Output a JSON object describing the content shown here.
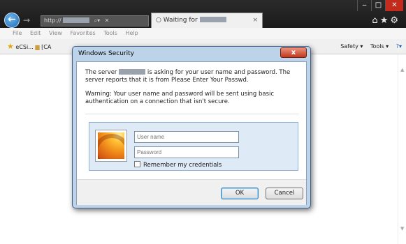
{
  "browser": {
    "address": "http://",
    "tab_title": "Waiting for",
    "window_controls": [
      "‒",
      "□",
      "✕"
    ],
    "menu": [
      "File",
      "Edit",
      "View",
      "Favorites",
      "Tools",
      "Help"
    ],
    "favorites": [
      "eCSi...",
      "[CA"
    ],
    "toolbar_right": [
      "Safety ▾",
      "Tools ▾",
      "?▾"
    ]
  },
  "dialog": {
    "title": "Windows Security",
    "close_label": "x",
    "message_part1": "The server",
    "message_part2": "is asking for your user name and password. The server reports that it is from Please Enter Your Passwd.",
    "warning": "Warning: Your user name and password will be sent using basic authentication on a connection that isn't secure.",
    "username_placeholder": "User name",
    "password_placeholder": "Password",
    "remember_label": "Remember my credentials",
    "ok_label": "OK",
    "cancel_label": "Cancel"
  },
  "colors": {
    "dialog_frame": "#bcd3ea",
    "panel_bg": "#dfeaf7",
    "close_red": "#c2381d"
  }
}
